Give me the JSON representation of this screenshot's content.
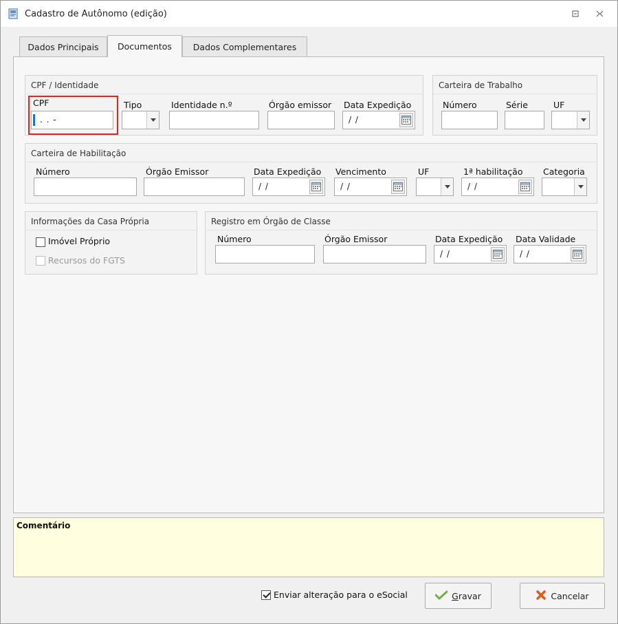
{
  "window": {
    "title": "Cadastro de Autônomo (edição)"
  },
  "tabs": [
    {
      "label": "Dados Principais",
      "active": false
    },
    {
      "label": "Documentos",
      "active": true
    },
    {
      "label": "Dados Complementares",
      "active": false
    }
  ],
  "cpf_identidade": {
    "title": "CPF / Identidade",
    "cpf_label": "CPF",
    "cpf_value": ". . -",
    "tipo_label": "Tipo",
    "identidade_label": "Identidade n.º",
    "orgao_label": "Órgão emissor",
    "data_expedicao_label": "Data Expedição",
    "data_expedicao_value": "/ /"
  },
  "carteira_trabalho": {
    "title": "Carteira de Trabalho",
    "numero_label": "Número",
    "serie_label": "Série",
    "uf_label": "UF"
  },
  "carteira_habilitacao": {
    "title": "Carteira de Habilitação",
    "numero_label": "Número",
    "orgao_label": "Órgão Emissor",
    "data_expedicao_label": "Data Expedição",
    "data_expedicao_value": "/ /",
    "vencimento_label": "Vencimento",
    "vencimento_value": "/ /",
    "uf_label": "UF",
    "primeira_habilitacao_label": "1ª habilitação",
    "primeira_habilitacao_value": "/ /",
    "categoria_label": "Categoria"
  },
  "casa_propria": {
    "title": "Informações da Casa Própria",
    "imovel_label": "Imóvel Próprio",
    "fgts_label": "Recursos do FGTS"
  },
  "orgao_classe": {
    "title": "Registro em Órgão de Classe",
    "numero_label": "Número",
    "orgao_label": "Órgão Emissor",
    "data_expedicao_label": "Data Expedição",
    "data_expedicao_value": "/ /",
    "data_validade_label": "Data Validade",
    "data_validade_value": "/ /"
  },
  "comentario": {
    "label": "Comentário"
  },
  "footer": {
    "esocial_label": "Enviar alteração para o eSocial",
    "esocial_checked": true,
    "gravar_prefix": "",
    "gravar_underlined": "G",
    "gravar_rest": "ravar",
    "cancelar_label": "Cancelar"
  },
  "colors": {
    "highlight": "#e02424",
    "comment_bg": "#ffffe0",
    "gravar_icon": "#6db33f",
    "cancelar_icon": "#e05a1c"
  }
}
